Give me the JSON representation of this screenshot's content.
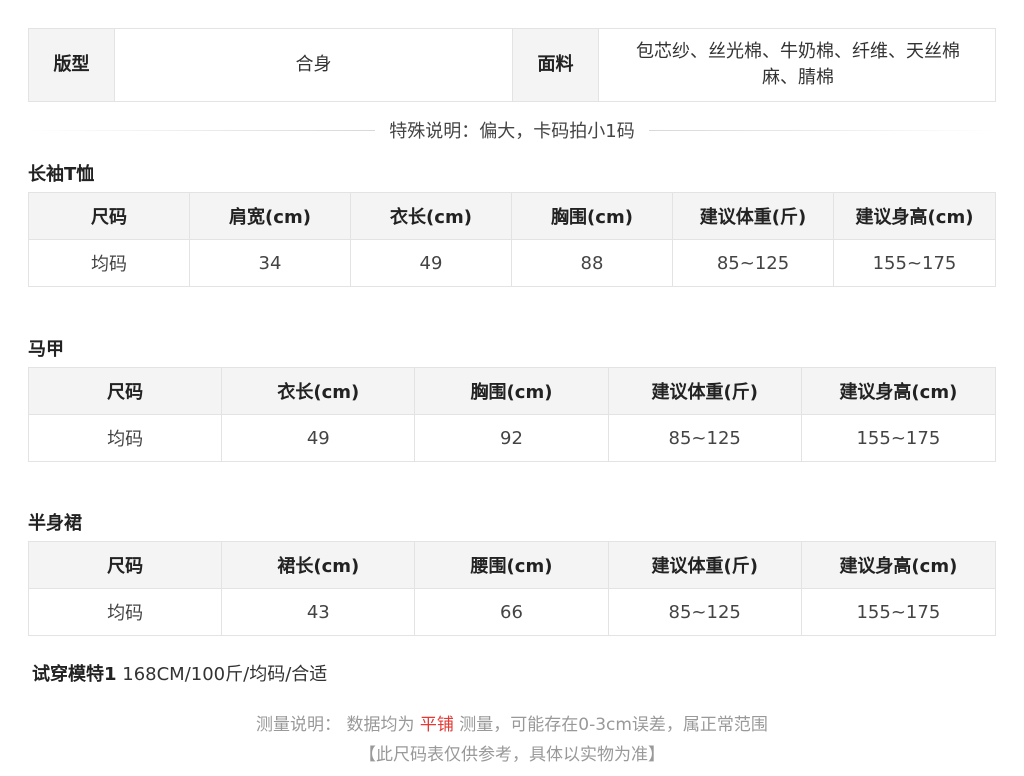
{
  "top_table": {
    "style_label": "版型",
    "style_value": "合身",
    "fabric_label": "面料",
    "fabric_line1": "包芯纱、丝光棉、牛奶棉、纤维、天丝棉",
    "fabric_line2": "麻、腈棉"
  },
  "special_note": "特殊说明：偏大，卡码拍小1码",
  "sections": {
    "tshirt": {
      "title": "长袖T恤",
      "headers": [
        "尺码",
        "肩宽(cm)",
        "衣长(cm)",
        "胸围(cm)",
        "建议体重(斤)",
        "建议身高(cm)"
      ],
      "row": [
        "均码",
        "34",
        "49",
        "88",
        "85~125",
        "155~175"
      ]
    },
    "vest": {
      "title": "马甲",
      "headers": [
        "尺码",
        "衣长(cm)",
        "胸围(cm)",
        "建议体重(斤)",
        "建议身高(cm)"
      ],
      "row": [
        "均码",
        "49",
        "92",
        "85~125",
        "155~175"
      ]
    },
    "skirt": {
      "title": "半身裙",
      "headers": [
        "尺码",
        "裙长(cm)",
        "腰围(cm)",
        "建议体重(斤)",
        "建议身高(cm)"
      ],
      "row": [
        "均码",
        "43",
        "66",
        "85~125",
        "155~175"
      ]
    }
  },
  "model": {
    "label": "试穿模特1",
    "value": " 168CM/100斤/均码/合适"
  },
  "footer": {
    "prefix": "测量说明：  数据均为 ",
    "highlight": "平铺",
    "suffix": " 测量，可能存在0-3cm误差，属正常范围",
    "disclaimer": "【此尺码表仅供参考，具体以实物为准】"
  },
  "colors": {
    "highlight": "#e53935",
    "header_bg": "#f4f4f4",
    "border": "#e3e3e3"
  }
}
